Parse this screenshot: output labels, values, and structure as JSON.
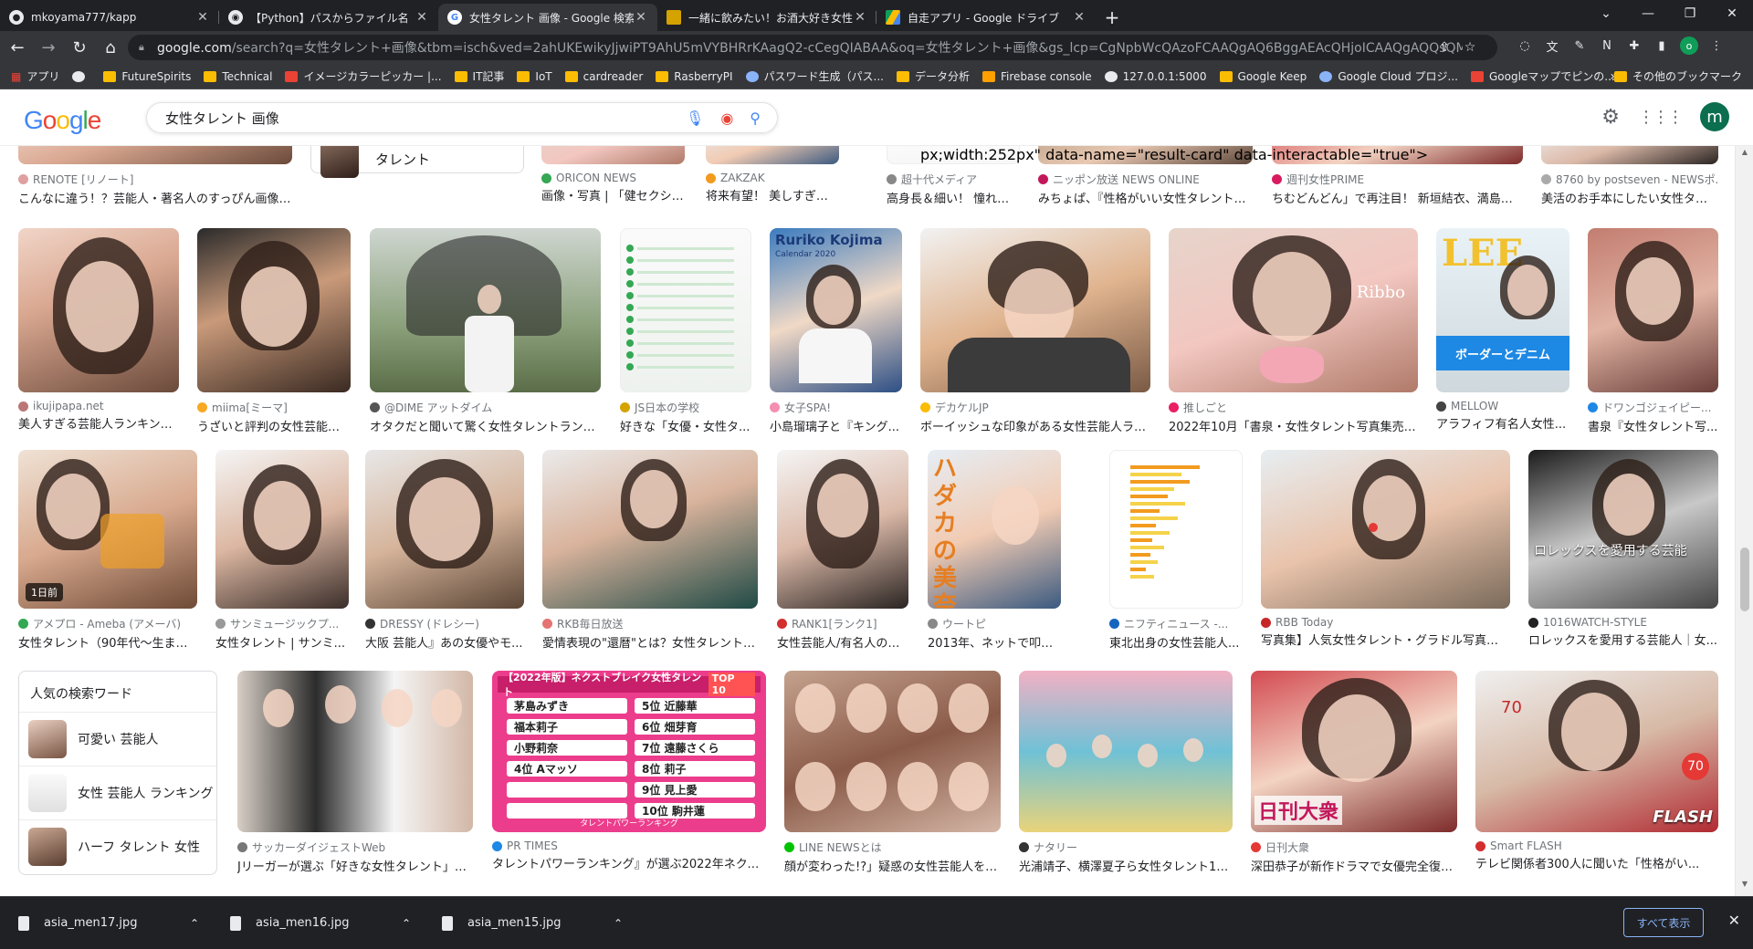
{
  "browser": {
    "tabs": [
      {
        "title": "mkoyama777/kapp",
        "icon": "github-icon",
        "active": false
      },
      {
        "title": "【Python】パスからファイル名（拡張",
        "icon": "python-icon",
        "active": false
      },
      {
        "title": "女性タレント 画像 - Google 検索",
        "icon": "google-icon",
        "active": true
      },
      {
        "title": "一緒に飲みたい！お酒大好き女性タ",
        "icon": "site-icon",
        "active": false
      },
      {
        "title": "自走アプリ - Google ドライブ",
        "icon": "drive-icon",
        "active": false
      }
    ],
    "new_tab": "+",
    "url_domain": "google.com",
    "url_rest": "/search?q=女性タレント+画像&tbm=isch&ved=2ahUKEwikyJjwiPT9AhU5mVYBHRrKAagQ2-cCegQIABAA&oq=女性タレント+画像&gs_lcp=CgNpbWcQAzoFCAAQgAQ6BggAEAcQHjoICAAQgAQQsQM6CCQgAEAQQgAQ...",
    "bookmarks": [
      {
        "label": "アプリ",
        "kind": "apps"
      },
      {
        "label": "",
        "kind": "globe"
      },
      {
        "label": "FutureSpirits",
        "kind": "folder"
      },
      {
        "label": "Technical",
        "kind": "folder"
      },
      {
        "label": "イメージカラーピッカー |...",
        "kind": "site"
      },
      {
        "label": "IT記事",
        "kind": "folder"
      },
      {
        "label": "IoT",
        "kind": "folder"
      },
      {
        "label": "cardreader",
        "kind": "folder"
      },
      {
        "label": "RasberryPI",
        "kind": "folder"
      },
      {
        "label": "パスワード生成（パス...",
        "kind": "site"
      },
      {
        "label": "データ分析",
        "kind": "folder"
      },
      {
        "label": "Firebase console",
        "kind": "site"
      },
      {
        "label": "127.0.0.1:5000",
        "kind": "globe"
      },
      {
        "label": "Google Keep",
        "kind": "site"
      },
      {
        "label": "Google Cloud プロジ...",
        "kind": "site"
      },
      {
        "label": "Googleマップでピンの...",
        "kind": "site"
      }
    ],
    "bookmarks_more": "»",
    "other_bookmarks": "その他のブックマーク"
  },
  "google": {
    "logo": [
      "G",
      "o",
      "o",
      "g",
      "l",
      "e"
    ],
    "query": "女性タレント 画像",
    "avatar_letter": "m"
  },
  "top_row": [
    {
      "source": "RENOTE [リノート]",
      "title": "こんなに違う！？芸能人・著名人のすっぴん画像ま..."
    },
    {
      "source": "ORICON NEWS",
      "title": "画像・写真 | 「健セクシー..."
    },
    {
      "source": "ZAKZAK",
      "title": "将来有望！ 美しすぎる10代の..."
    },
    {
      "source": "超十代メディア",
      "title": "高身長＆細い！ 憧れち..."
    },
    {
      "source": "ニッポン放送 NEWS ONLINE",
      "title": "みちょぱ、『性格がいい女性タレントラ..."
    },
    {
      "source": "週刊女性PRIME",
      "title": "ちむどんどん」で再注目！ 新垣結衣、満島ひ..."
    },
    {
      "source": "8760 by postseven - NEWSポ...",
      "title": "美活のお手本にしたい女性タレ..."
    }
  ],
  "talent_chip": "タレント",
  "row1": [
    {
      "source": "ikujipapa.net",
      "title": "美人すぎる芸能人ランキング..."
    },
    {
      "source": "miima[ミーマ]",
      "title": "うざいと評判の女性芸能人..."
    },
    {
      "source": "@DIME アットダイム",
      "title": "オタクだと聞いて驚く女性タレントランキ..."
    },
    {
      "source": "JS日本の学校",
      "title": "好きな「女優・女性タ..."
    },
    {
      "source": "女子SPA!",
      "title": "小島瑠璃子と『キング..."
    },
    {
      "source": "デカケルJP",
      "title": "ボーイッシュな印象がある女性芸能人ラン..."
    },
    {
      "source": "推しごと",
      "title": "2022年10月「書泉・女性タレント写真集売上..."
    },
    {
      "source": "MELLOW",
      "title": "アラフィフ有名人女性..."
    },
    {
      "source": "ドワンゴジェイピー...",
      "title": "書泉『女性タレント写..."
    }
  ],
  "row1_text": {
    "magazine_title": "Ruriko Kojima",
    "magazine_sub": "Calendar 2020",
    "ribbon": "Ribbo",
    "lee": "LEE",
    "lee_sub": "ボーダーとデニム"
  },
  "row2": [
    {
      "source": "アメプロ - Ameba (アメーバ)",
      "title": "女性タレント（90年代〜生まれ...",
      "badge": "1日前"
    },
    {
      "source": "サンミュージックプ...",
      "title": "女性タレント | サンミ..."
    },
    {
      "source": "DRESSY (ドレシー)",
      "title": "大阪 芸能人』あの女優やモ..."
    },
    {
      "source": "RKB毎日放送",
      "title": "愛情表現の\"還暦\"とは？女性タレントの..."
    },
    {
      "source": "RANK1[ランク1]",
      "title": "女性芸能人/有名人の人..."
    },
    {
      "source": "ウートピ",
      "title": "2013年、ネットで叩かれた女..."
    },
    {
      "source": "ニフティニュース -...",
      "title": "東北出身の女性芸能人..."
    },
    {
      "source": "RBB Today",
      "title": "写真集】人気女性タレント・グラドル写真集65..."
    },
    {
      "source": "1016WATCH-STYLE",
      "title": "ロレックスを愛用する芸能人｜女..."
    }
  ],
  "row2_text": {
    "book_title": "ハダカの美奈子",
    "rolex": "ロレックスを愛用する芸能"
  },
  "related": {
    "heading": "人気の検索ワード",
    "items": [
      "可愛い 芸能人",
      "女性 芸能人 ランキング",
      "ハーフ タレント 女性"
    ]
  },
  "row3": [
    {
      "source": "サッカーダイジェストWeb",
      "title": "Jリーガーが選ぶ「好きな女性タレント」ラ..."
    },
    {
      "source": "PR TIMES",
      "title": "タレントパワーランキング』が選ぶ2022年ネクスト..."
    },
    {
      "source": "LINE NEWSとは",
      "title": "顔が変わった!?」疑惑の女性芸能人を高須院長..."
    },
    {
      "source": "ナタリー",
      "title": "光浦靖子、横澤夏子ら女性タレント10..."
    },
    {
      "source": "日刊大衆",
      "title": "深田恭子が新作ドラマで女優完全復帰..."
    },
    {
      "source": "Smart FLASH",
      "title": "テレビ関係者300人に聞いた「性格がい..."
    }
  ],
  "ranking": {
    "header": "【2022年版】ネクストブレイク女性タレント",
    "top": "TOP 10",
    "entries": [
      "茅島みずき",
      "5位 近藤華",
      "福本莉子",
      "6位 畑芽育",
      "小野莉奈",
      "7位 遠藤さくら",
      "4位 Aマッソ",
      "8位 莉子",
      "",
      "9位 見上愛",
      "",
      "10位 駒井蓮"
    ],
    "footer": "タレントパワーランキング"
  },
  "row3_text": {
    "nikkan": "日刊大衆",
    "flash": "FLASH",
    "seventy": "70"
  },
  "downloads": [
    {
      "name": "asia_men17.jpg"
    },
    {
      "name": "asia_men16.jpg"
    },
    {
      "name": "asia_men15.jpg"
    }
  ],
  "show_all": "すべて表示",
  "colors": {
    "accent": "#1a73e8",
    "chrome_dark": "#202124",
    "chrome_mid": "#35363a"
  }
}
